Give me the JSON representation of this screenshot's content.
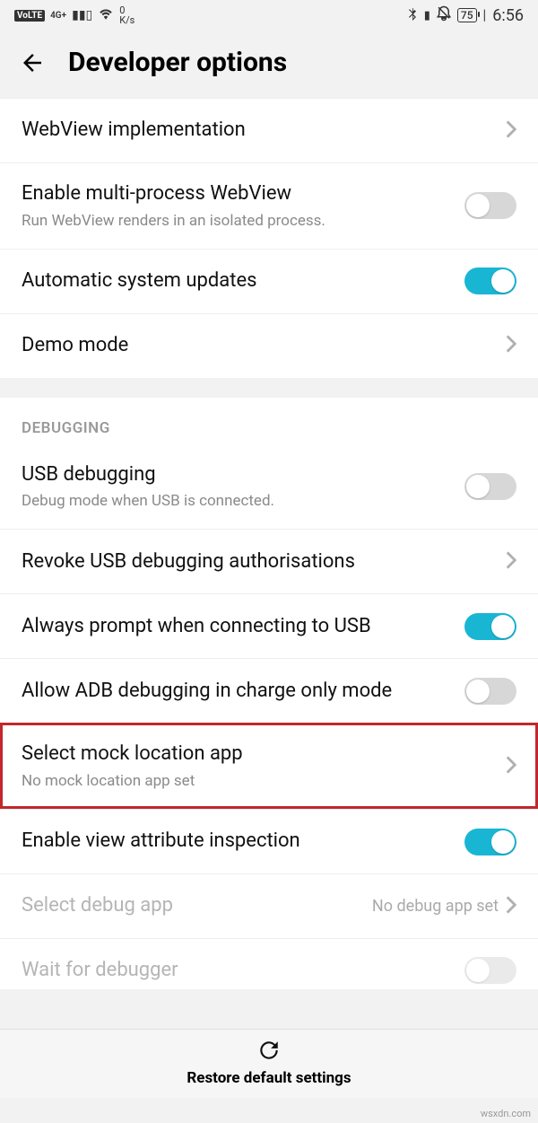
{
  "status": {
    "volte": "VoLTE",
    "net": "4G+",
    "speed_top": "0",
    "speed_unit": "K/s",
    "battery": "75",
    "time": "6:56"
  },
  "header": {
    "title": "Developer options"
  },
  "group1": {
    "webview_impl": "WebView implementation",
    "multi_webview_title": "Enable multi-process WebView",
    "multi_webview_sub": "Run WebView renders in an isolated process.",
    "auto_updates": "Automatic system updates",
    "demo_mode": "Demo mode"
  },
  "debugging": {
    "label": "DEBUGGING",
    "usb_title": "USB debugging",
    "usb_sub": "Debug mode when USB is connected.",
    "revoke": "Revoke USB debugging authorisations",
    "prompt_usb": "Always prompt when connecting to USB",
    "adb_charge": "Allow ADB debugging in charge only mode",
    "mock_title": "Select mock location app",
    "mock_sub": "No mock location app set",
    "view_attr": "Enable view attribute inspection",
    "select_debug_title": "Select debug app",
    "select_debug_value": "No debug app set",
    "wait_debugger": "Wait for debugger"
  },
  "footer": {
    "restore": "Restore default settings"
  },
  "watermark": "wsxdn.com"
}
